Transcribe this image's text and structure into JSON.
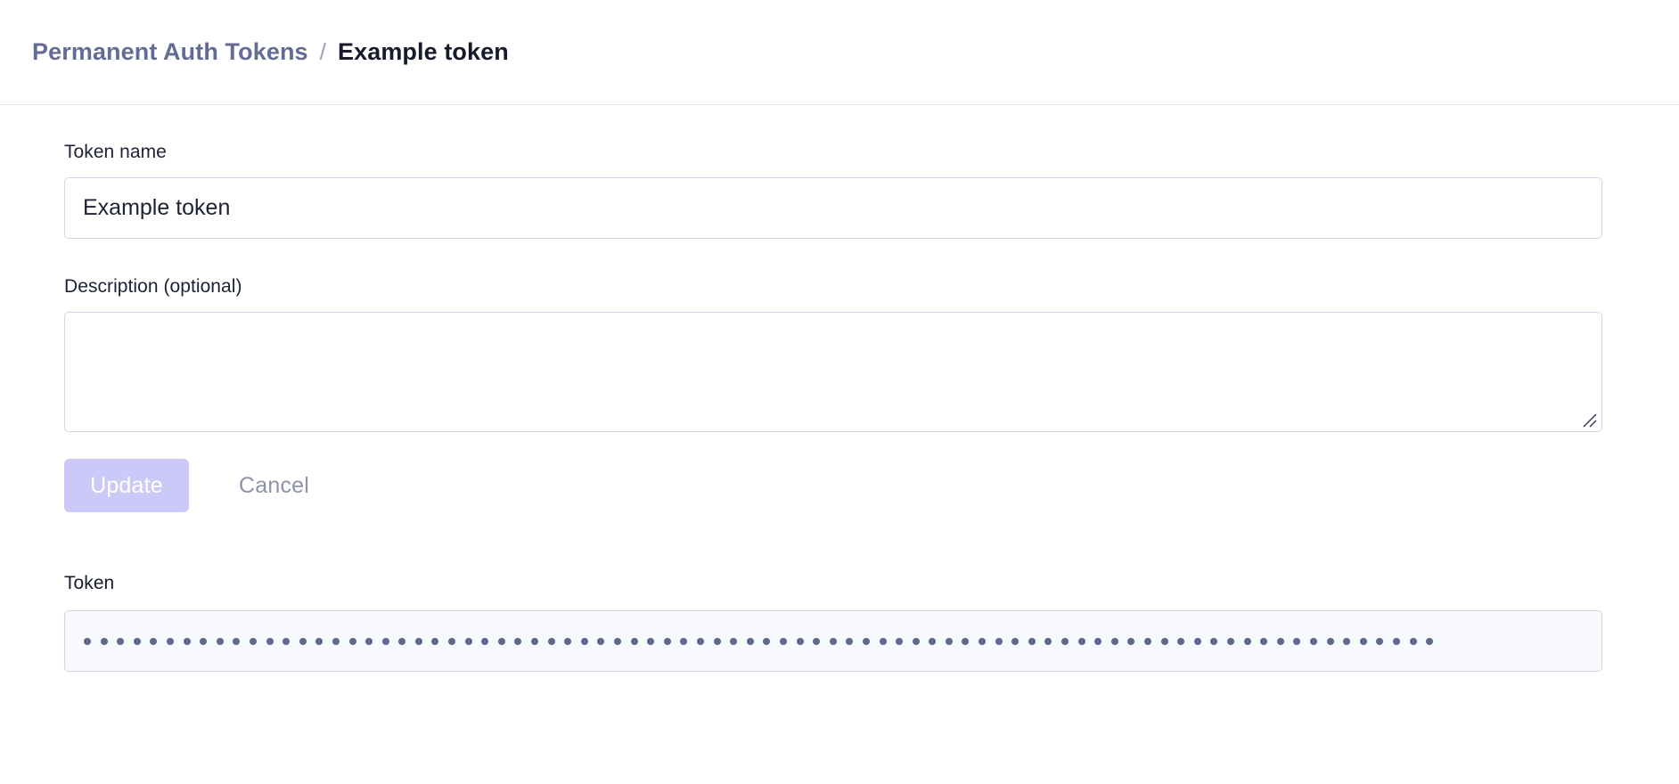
{
  "breadcrumb": {
    "parent_label": "Permanent Auth Tokens",
    "separator": "/",
    "current_label": "Example token"
  },
  "form": {
    "token_name": {
      "label": "Token name",
      "value": "Example token",
      "placeholder": ""
    },
    "description": {
      "label": "Description (optional)",
      "value": "",
      "placeholder": ""
    },
    "actions": {
      "update_label": "Update",
      "update_disabled": true,
      "cancel_label": "Cancel"
    },
    "token": {
      "label": "Token",
      "masked": true,
      "mask_character": "•",
      "mask_length": 82,
      "value": ""
    }
  },
  "colors": {
    "breadcrumb_link": "#626c95",
    "breadcrumb_current": "#161a2b",
    "label_text": "#1d2135",
    "field_border": "#d3d6e8",
    "update_button_bg": "#ccc9f9",
    "update_button_text": "#ffffff",
    "cancel_text": "#8e93ab",
    "token_field_bg": "#f8f9fd",
    "token_dot": "#5e6890",
    "header_divider": "#e7e8ef",
    "page_bg": "#ffffff"
  },
  "icons": {
    "resize_grip": "resize-grip-icon"
  }
}
